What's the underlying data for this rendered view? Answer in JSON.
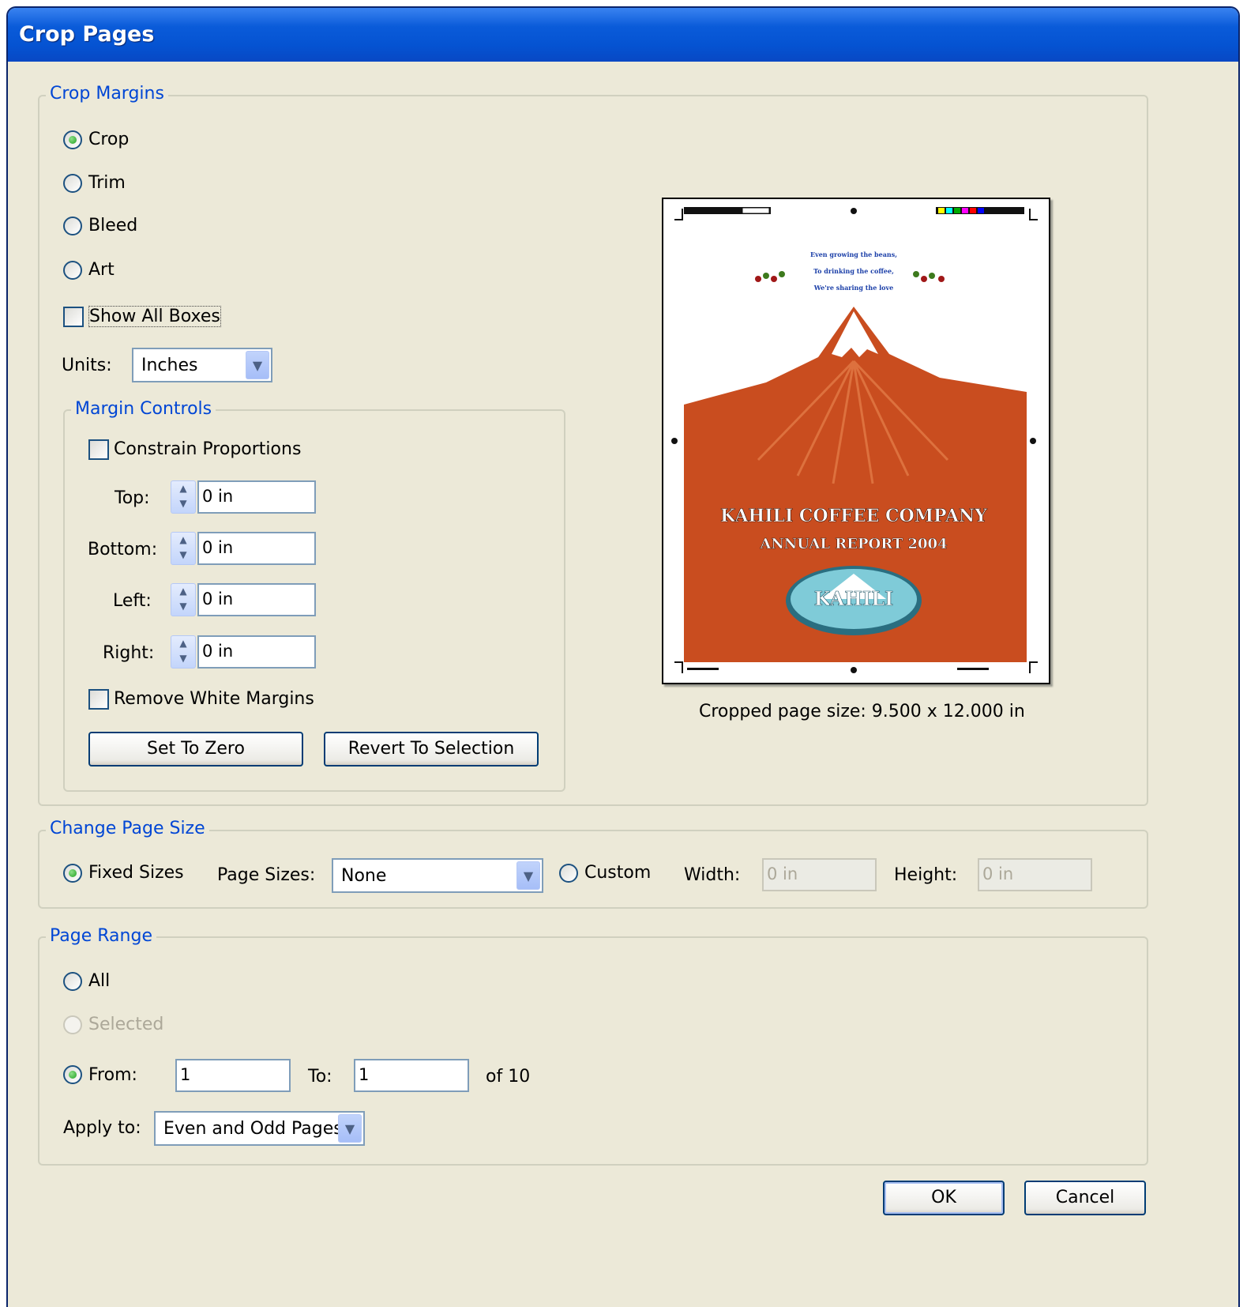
{
  "window": {
    "title": "Crop Pages"
  },
  "crop_margins": {
    "legend": "Crop Margins",
    "box_options": [
      {
        "label": "Crop",
        "selected": true
      },
      {
        "label": "Trim",
        "selected": false
      },
      {
        "label": "Bleed",
        "selected": false
      },
      {
        "label": "Art",
        "selected": false
      }
    ],
    "show_all_boxes": {
      "label": "Show All Boxes",
      "checked": false
    },
    "units": {
      "label": "Units:",
      "value": "Inches"
    },
    "margin_controls": {
      "legend": "Margin Controls",
      "constrain_proportions": {
        "label": "Constrain Proportions",
        "checked": false
      },
      "top": {
        "label": "Top:",
        "value": "0 in"
      },
      "bottom": {
        "label": "Bottom:",
        "value": "0 in"
      },
      "left": {
        "label": "Left:",
        "value": "0 in"
      },
      "right": {
        "label": "Right:",
        "value": "0 in"
      },
      "remove_white_margins": {
        "label": "Remove White Margins",
        "checked": false
      },
      "set_to_zero": "Set To Zero",
      "revert_to_selection": "Revert To Selection"
    },
    "preview": {
      "doc_lines": [
        "Even growing the beans,",
        "To drinking the coffee,",
        "We're sharing the love"
      ],
      "company": "KAHILI COFFEE COMPANY",
      "report": "ANNUAL REPORT 2004",
      "logo": "KAHILI",
      "caption": "Cropped page size: 9.500 x 12.000 in"
    }
  },
  "change_page_size": {
    "legend": "Change Page Size",
    "fixed_sizes": {
      "label": "Fixed Sizes",
      "selected": true
    },
    "page_sizes": {
      "label": "Page Sizes:",
      "value": "None"
    },
    "custom": {
      "label": "Custom",
      "selected": false
    },
    "width": {
      "label": "Width:",
      "value": "0 in"
    },
    "height": {
      "label": "Height:",
      "value": "0 in"
    }
  },
  "page_range": {
    "legend": "Page Range",
    "all": {
      "label": "All",
      "selected": false
    },
    "selected": {
      "label": "Selected",
      "selected": false
    },
    "from": {
      "label": "From:",
      "value": "1",
      "selected": true
    },
    "to": {
      "label": "To:",
      "value": "1"
    },
    "of_total": "of 10",
    "apply_to": {
      "label": "Apply to:",
      "value": "Even and Odd Pages"
    }
  },
  "footer": {
    "ok": "OK",
    "cancel": "Cancel"
  },
  "colors": {
    "title_bar": "#0553D2",
    "dialog_bg": "#ECE9D8",
    "group_legend": "#0046D5",
    "preview_orange": "#C94D1F"
  }
}
